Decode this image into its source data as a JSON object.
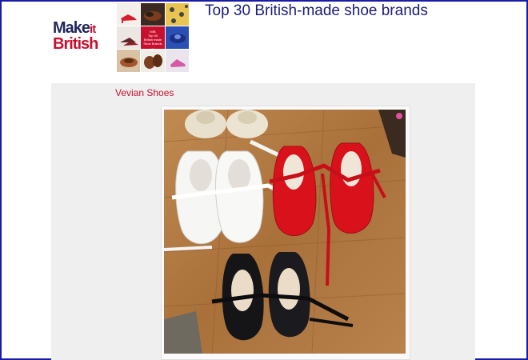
{
  "logo": {
    "line1_make": "Make",
    "line1_it": "it",
    "line2": "British"
  },
  "header": {
    "title": "Top 30 British-made shoe brands"
  },
  "mosaic": {
    "center_text": "MIB\nTop 30\nBritish made\nShoe Brands\n..."
  },
  "article": {
    "caption": "Vevian Shoes"
  },
  "photo": {
    "description_icons": [
      "shoe-icon"
    ],
    "colors": {
      "wood": "#b0773f",
      "red": "#d8111b",
      "white": "#f6f6f4",
      "black": "#151518",
      "cream": "#e8e0cc"
    }
  }
}
